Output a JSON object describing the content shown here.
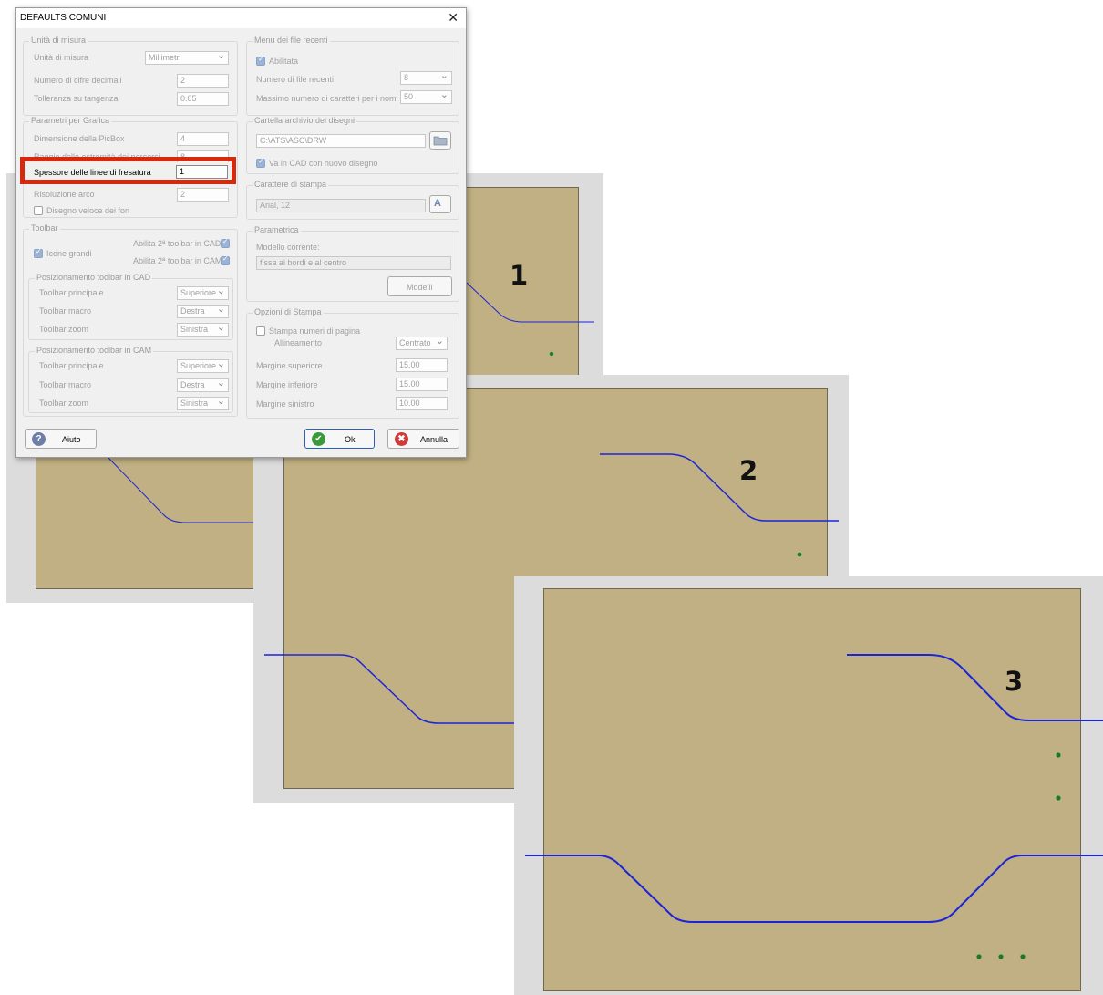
{
  "dialog": {
    "title": "DEFAULTS COMUNI",
    "close_icon": "close-icon",
    "unita": {
      "title": "Unità di misura",
      "unit_label": "Unità di misura",
      "unit_value": "Millimetri",
      "decimals_label": "Numero di cifre decimali",
      "decimals_value": "2",
      "tolerance_label": "Tolleranza su tangenza",
      "tolerance_value": "0.05"
    },
    "grafica": {
      "title": "Parametri per Grafica",
      "picbox_label": "Dimensione della PicBox",
      "picbox_value": "4",
      "raggio_label": "Raggio delle estremità dei percorsi",
      "raggio_value": "8",
      "spessore_label": "Spessore delle linee di fresatura",
      "spessore_value": "1",
      "risoluzione_label": "Risoluzione arco",
      "risoluzione_value": "2",
      "fori_label": "Disegno veloce dei fori"
    },
    "toolbar": {
      "title": "Toolbar",
      "icone_label": "Icone grandi",
      "cad2_label": "Abilita 2ª toolbar in CAD",
      "cam2_label": "Abilita 2ª toolbar in CAM",
      "cad": {
        "title": "Posizionamento toolbar in CAD",
        "principale_label": "Toolbar principale",
        "principale_value": "Superiore",
        "macro_label": "Toolbar macro",
        "macro_value": "Destra",
        "zoom_label": "Toolbar zoom",
        "zoom_value": "Sinistra"
      },
      "cam": {
        "title": "Posizionamento toolbar in CAM",
        "principale_label": "Toolbar principale",
        "principale_value": "Superiore",
        "macro_label": "Toolbar macro",
        "macro_value": "Destra",
        "zoom_label": "Toolbar zoom",
        "zoom_value": "Sinistra"
      }
    },
    "recenti": {
      "title": "Menu dei file recenti",
      "abilitata_label": "Abilitata",
      "numero_label": "Numero di file recenti",
      "numero_value": "8",
      "massimo_label": "Massimo numero di caratteri per i nomi",
      "massimo_value": "50"
    },
    "cartella": {
      "title": "Cartella archivio dei disegni",
      "path_value": "C:\\ATS\\ASC\\DRW",
      "cad_label": "Va in CAD con nuovo disegno",
      "folder_icon": "folder-icon"
    },
    "carattere": {
      "title": "Carattere di stampa",
      "font_value": "Arial, 12",
      "font_icon": "font-icon"
    },
    "parametrica": {
      "title": "Parametrica",
      "modello_label": "Modello corrente:",
      "modello_value": "fissa ai bordi e al centro",
      "modelli_button": "Modelli"
    },
    "stampa": {
      "title": "Opzioni di Stampa",
      "numeri_label": "Stampa numeri di pagina",
      "allineamento_label": "Allineamento",
      "allineamento_value": "Centrato",
      "superiore_label": "Margine superiore",
      "superiore_value": "15.00",
      "inferiore_label": "Margine inferiore",
      "inferiore_value": "15.00",
      "sinistro_label": "Margine sinistro",
      "sinistro_value": "10.00"
    },
    "buttons": {
      "aiuto": "Aiuto",
      "ok": "Ok",
      "annulla": "Annulla"
    }
  },
  "previews": [
    {
      "number": "1",
      "stroke_width": 1
    },
    {
      "number": "2",
      "stroke_width": 1.5
    },
    {
      "number": "3",
      "stroke_width": 2
    }
  ],
  "colors": {
    "board": "#c0b083",
    "path": "#1d24d6",
    "dots": "#1a7a2c",
    "highlight": "#d42a10",
    "panel": "#dcdcdc"
  }
}
